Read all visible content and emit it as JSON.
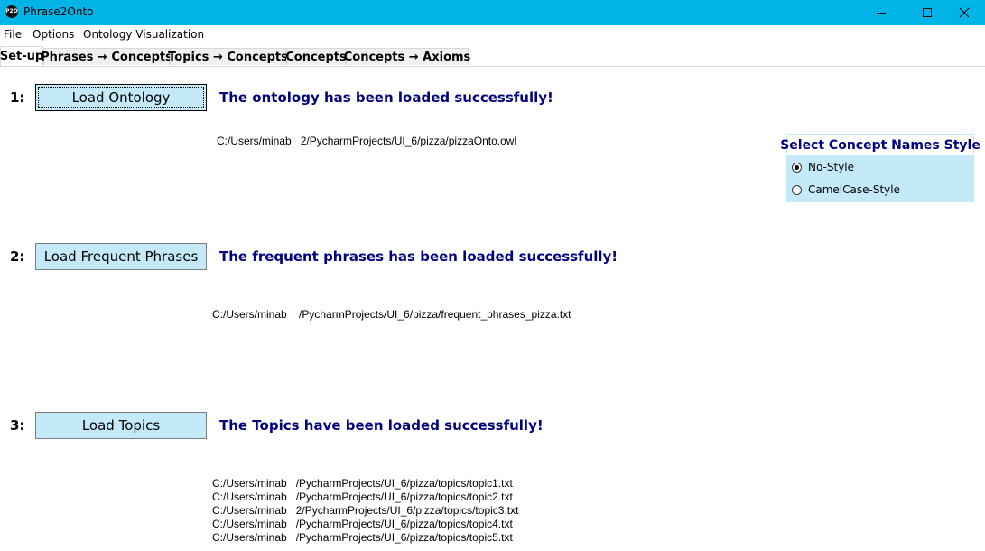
{
  "window": {
    "title": "Phrase2Onto",
    "icon": "P2O",
    "controls": [
      "minimize-icon",
      "maximize-icon",
      "close-icon"
    ]
  },
  "menu": {
    "items": [
      "File",
      "Options",
      "Ontology Visualization"
    ]
  },
  "tabs": [
    {
      "label": "Set-up",
      "active": true
    },
    {
      "label": "Phrases → Concepts",
      "active": false
    },
    {
      "label": "Topics → Concepts",
      "active": false
    },
    {
      "label": "Concepts",
      "active": false
    },
    {
      "label": "Concepts → Axioms",
      "active": false
    }
  ],
  "steps": [
    {
      "number": "1:",
      "button": "Load Ontology",
      "status": "The ontology has been loaded successfully!",
      "paths": [
        "C:/Users/minab   2/PycharmProjects/UI_6/pizza/pizzaOnto.owl"
      ]
    },
    {
      "number": "2:",
      "button": "Load Frequent Phrases",
      "status": "The frequent phrases has been loaded successfully!",
      "paths": [
        "C:/Users/minab    /PycharmProjects/UI_6/pizza/frequent_phrases_pizza.txt"
      ]
    },
    {
      "number": "3:",
      "button": "Load Topics",
      "status": "The Topics have been loaded successfully!",
      "paths": [
        "C:/Users/minab   /PycharmProjects/UI_6/pizza/topics/topic1.txt",
        "C:/Users/minab   /PycharmProjects/UI_6/pizza/topics/topic2.txt",
        "C:/Users/minab   2/PycharmProjects/UI_6/pizza/topics/topic3.txt",
        "C:/Users/minab   /PycharmProjects/UI_6/pizza/topics/topic4.txt",
        "C:/Users/minab   /PycharmProjects/UI_6/pizza/topics/topic5.txt"
      ]
    }
  ],
  "concept_style": {
    "title": "Select Concept Names Style",
    "options": [
      {
        "label": "No-Style",
        "checked": true
      },
      {
        "label": "CamelCase-Style",
        "checked": false
      }
    ]
  },
  "colors": {
    "titlebar": "#00b4e8",
    "button_bg": "#c4eafa",
    "status_text": "#000080"
  }
}
